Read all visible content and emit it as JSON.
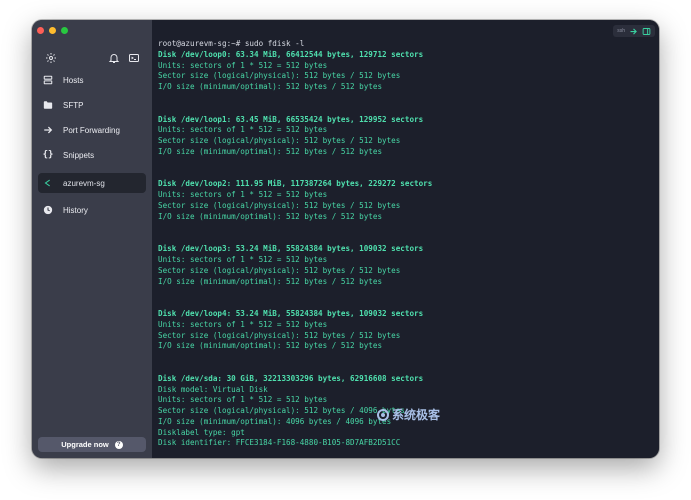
{
  "sidebar": {
    "items": [
      {
        "label": "Hosts",
        "icon": "server-icon"
      },
      {
        "label": "SFTP",
        "icon": "folder-icon"
      },
      {
        "label": "Port Forwarding",
        "icon": "arrow-right-icon"
      },
      {
        "label": "Snippets",
        "icon": "braces-icon"
      },
      {
        "label": "azurevm-sg",
        "icon": "terminal-tab-icon",
        "active": true
      },
      {
        "label": "History",
        "icon": "clock-icon"
      }
    ],
    "upgrade_label": "Upgrade now",
    "upgrade_badge": "?"
  },
  "terminal": {
    "lines": [
      "root@azurevm-sg:~# sudo fdisk -l",
      "Disk /dev/loop0: 63.34 MiB, 66412544 bytes, 129712 sectors",
      "Units: sectors of 1 * 512 = 512 bytes",
      "Sector size (logical/physical): 512 bytes / 512 bytes",
      "I/O size (minimum/optimal): 512 bytes / 512 bytes",
      "",
      "",
      "Disk /dev/loop1: 63.45 MiB, 66535424 bytes, 129952 sectors",
      "Units: sectors of 1 * 512 = 512 bytes",
      "Sector size (logical/physical): 512 bytes / 512 bytes",
      "I/O size (minimum/optimal): 512 bytes / 512 bytes",
      "",
      "",
      "Disk /dev/loop2: 111.95 MiB, 117387264 bytes, 229272 sectors",
      "Units: sectors of 1 * 512 = 512 bytes",
      "Sector size (logical/physical): 512 bytes / 512 bytes",
      "I/O size (minimum/optimal): 512 bytes / 512 bytes",
      "",
      "",
      "Disk /dev/loop3: 53.24 MiB, 55824384 bytes, 109032 sectors",
      "Units: sectors of 1 * 512 = 512 bytes",
      "Sector size (logical/physical): 512 bytes / 512 bytes",
      "I/O size (minimum/optimal): 512 bytes / 512 bytes",
      "",
      "",
      "Disk /dev/loop4: 53.24 MiB, 55824384 bytes, 109032 sectors",
      "Units: sectors of 1 * 512 = 512 bytes",
      "Sector size (logical/physical): 512 bytes / 512 bytes",
      "I/O size (minimum/optimal): 512 bytes / 512 bytes",
      "",
      "",
      "Disk /dev/sda: 30 GiB, 32213303296 bytes, 62916608 sectors",
      "Disk model: Virtual Disk",
      "Units: sectors of 1 * 512 = 512 bytes",
      "Sector size (logical/physical): 512 bytes / 4096 bytes",
      "I/O size (minimum/optimal): 4096 bytes / 4096 bytes",
      "Disklabel type: gpt",
      "Disk identifier: FFCE3184-F168-4880-B105-8D7AFB2D51CC"
    ],
    "toolbar_pill": "ssh"
  },
  "watermark": "系统极客",
  "colors": {
    "sidebar_bg": "#3a3d4a",
    "terminal_bg": "#1c1f2b",
    "terminal_text": "#48d7a6",
    "accent": "#39d0a0"
  }
}
